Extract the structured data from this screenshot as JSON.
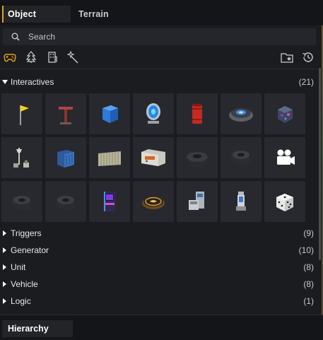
{
  "tabs": {
    "object": "Object",
    "terrain": "Terrain"
  },
  "search": {
    "placeholder": "Search"
  },
  "filter_icons": [
    "gamepad-icon",
    "tree-icon",
    "building-icon",
    "magic-wand-icon"
  ],
  "right_icons": [
    "folder-star-icon",
    "history-icon"
  ],
  "accent_color": "#e8a21a",
  "sections": {
    "interactives": {
      "label": "Interactives",
      "count": "(21)",
      "expanded": true
    },
    "triggers": {
      "label": "Triggers",
      "count": "(9)"
    },
    "generator": {
      "label": "Generator",
      "count": "(10)"
    },
    "unit": {
      "label": "Unit",
      "count": "(8)"
    },
    "vehicle": {
      "label": "Vehicle",
      "count": "(8)"
    },
    "logic": {
      "label": "Logic",
      "count": "(1)"
    }
  },
  "asset_icons": [
    "yellow-flag-icon",
    "signpost-icon",
    "blue-cube-icon",
    "portal-gem-icon",
    "red-barrel-icon",
    "teleport-pad-icon",
    "crystal-crate-icon",
    "lamp-robots-icon",
    "blue-container-icon",
    "fence-panel-icon",
    "cargo-container-icon",
    "tire-stack-icon",
    "tire-icon",
    "camera-icon",
    "tire-icon",
    "tire-icon",
    "arcade-cabinet-icon",
    "coin-pad-icon",
    "machine-icon",
    "tower-icon",
    "dice-icon"
  ],
  "bottom": {
    "hierarchy": "Hierarchy"
  }
}
